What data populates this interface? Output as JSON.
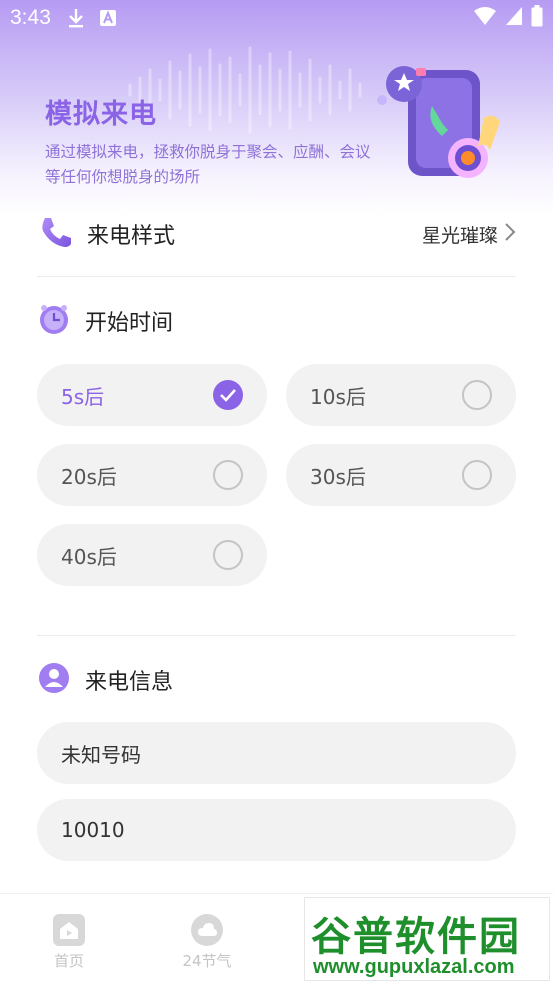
{
  "status_bar": {
    "time": "3:43"
  },
  "hero": {
    "title": "模拟来电",
    "subtitle": "通过模拟来电，拯救你脱身于聚会、应酬、会议等任何你想脱身的场所"
  },
  "call_style": {
    "label": "来电样式",
    "value": "星光璀璨"
  },
  "start_time": {
    "label": "开始时间",
    "options": [
      {
        "label": "5s后",
        "selected": true
      },
      {
        "label": "10s后",
        "selected": false
      },
      {
        "label": "20s后",
        "selected": false
      },
      {
        "label": "30s后",
        "selected": false
      },
      {
        "label": "40s后",
        "selected": false
      }
    ]
  },
  "caller_info": {
    "label": "来电信息",
    "name_value": "未知号码",
    "number_value": "10010"
  },
  "bottom_nav": {
    "tabs": [
      {
        "label": "首页",
        "icon": "home-icon"
      },
      {
        "label": "24节气",
        "icon": "weather-icon"
      }
    ]
  },
  "watermark": {
    "text": "谷普软件园",
    "url": "www.gupuxlazal.com"
  },
  "colors": {
    "accent": "#8a63e6",
    "field_bg": "#f2f2f2",
    "watermark": "#1f8f2c"
  }
}
